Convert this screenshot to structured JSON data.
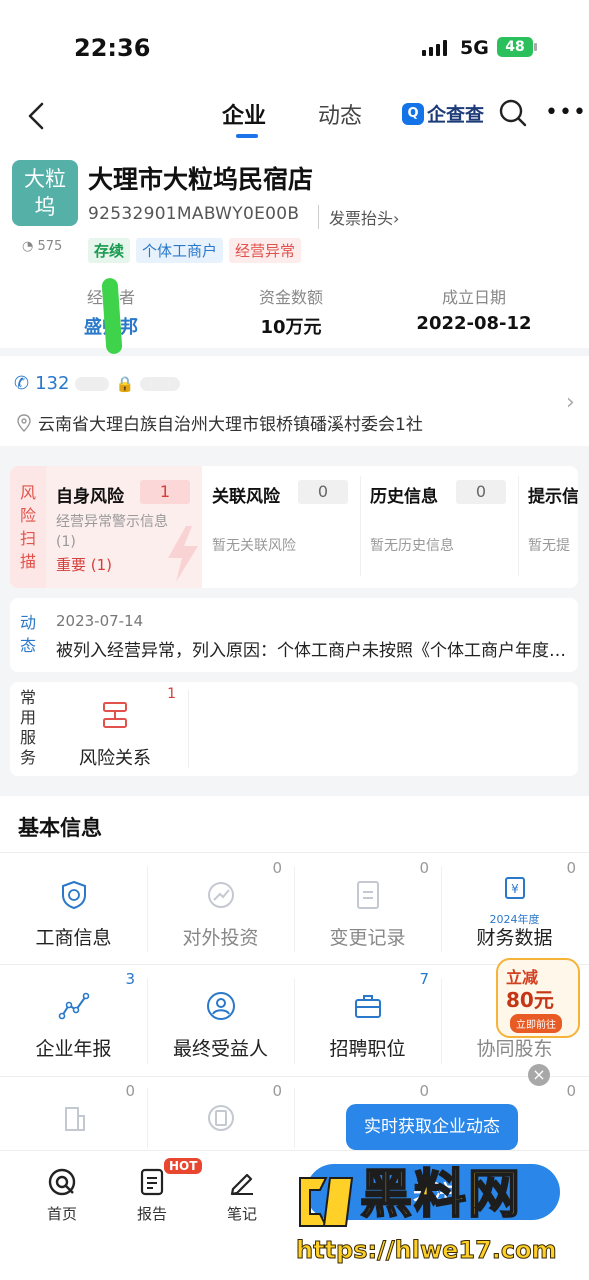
{
  "status": {
    "time": "22:36",
    "network": "5G",
    "battery": "48"
  },
  "nav": {
    "tabs": [
      "企业",
      "动态"
    ],
    "brand_icon": "Q",
    "brand": "企查查"
  },
  "company": {
    "logo_text_line1": "大粒",
    "logo_text_line2": "坞",
    "views": "575",
    "name": "大理市大粒坞民宿店",
    "credit_code": "92532901MABWY0E00B",
    "invoice_label": "发票抬头",
    "tags": [
      "存续",
      "个体工商户",
      "经营异常"
    ]
  },
  "key_info": [
    {
      "label": "经营者",
      "value": "盛帅邦"
    },
    {
      "label": "资金数额",
      "value": "10万元"
    },
    {
      "label": "成立日期",
      "value": "2022-08-12"
    }
  ],
  "contact": {
    "phone_prefix": "132",
    "address": "云南省大理白族自治州大理市银桥镇磻溪村委会1社"
  },
  "risk": {
    "label_chars": [
      "风",
      "险",
      "扫",
      "描"
    ],
    "self": {
      "title": "自身风险",
      "count": "1",
      "desc_line1": "经营异常警示信息",
      "desc_line2": "(1)",
      "important": "重要 (1)"
    },
    "related": {
      "title": "关联风险",
      "count": "0",
      "desc": "暂无关联风险"
    },
    "history": {
      "title": "历史信息",
      "count": "0",
      "desc": "暂无历史信息"
    },
    "hint": {
      "title": "提示信",
      "desc": "暂无提"
    }
  },
  "dynamics": {
    "label_chars": [
      "动",
      "态"
    ],
    "date": "2023-07-14",
    "text": "被列入经营异常，列入原因：个体工商户未按照《个体工商户年度报告暂行办法》规定报送年度报告"
  },
  "services": {
    "label_chars": [
      "常",
      "用",
      "服",
      "务"
    ],
    "items": [
      {
        "label": "风险关系",
        "badge": "1"
      }
    ]
  },
  "basic": {
    "title": "基本信息",
    "row1": [
      {
        "label": "工商信息",
        "count": "",
        "dim": false
      },
      {
        "label": "对外投资",
        "count": "0",
        "dim": true
      },
      {
        "label": "变更记录",
        "count": "0",
        "dim": true
      },
      {
        "label": "财务数据",
        "count": "0",
        "dim": false,
        "sub": "2024年度"
      }
    ],
    "row2": [
      {
        "label": "企业年报",
        "count": "3"
      },
      {
        "label": "最终受益人",
        "count": ""
      },
      {
        "label": "招聘职位",
        "count": "7"
      },
      {
        "label": "协同股东",
        "count": ""
      }
    ],
    "row3_counts": [
      "0",
      "0",
      "0",
      "0"
    ]
  },
  "promo": {
    "top": "立减",
    "amount": "80元",
    "cta": "立即前往"
  },
  "tooltip": "实时获取企业动态",
  "bottom_nav": [
    {
      "label": "首页"
    },
    {
      "label": "报告",
      "badge": "HOT"
    },
    {
      "label": "笔记"
    }
  ],
  "cta_label": "关注",
  "watermark": {
    "text": "黑料网",
    "url": "https://hlwe17.com"
  },
  "colors": {
    "accent": "#2a78c9",
    "risk": "#e0524b",
    "logo_bg": "#55b1a8"
  }
}
